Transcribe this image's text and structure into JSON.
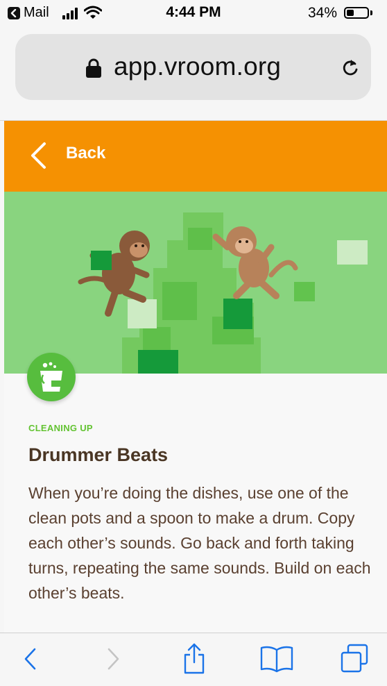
{
  "status_bar": {
    "back_app": "Mail",
    "time": "4:44 PM",
    "battery_percent": "34%",
    "battery_level": 0.34,
    "icons": [
      "back-arrow-icon",
      "signal-icon",
      "wifi-icon",
      "battery-icon"
    ]
  },
  "url_bar": {
    "domain": "app.vroom.org",
    "icons": [
      "lock-icon",
      "reload-icon"
    ]
  },
  "nav": {
    "back_label": "Back",
    "icon": "chevron-left-icon",
    "color": "#f59102"
  },
  "activity": {
    "category": "CLEANING UP",
    "title": "Drummer Beats",
    "description": "When you’re doing the dishes, use one of the clean pots and a spoon to make a drum. Copy each other’s sounds. Go back and forth taking turns, repeating the same sounds. Build on each other’s beats.",
    "badge_icon": "cleaning-bucket-icon",
    "illustration": "monkeys-illustration",
    "colors": {
      "category": "#63c332",
      "title": "#4a3624",
      "badge": "#57bd3e"
    }
  },
  "toolbar": {
    "items": [
      "back-icon",
      "forward-icon",
      "share-icon",
      "bookmarks-icon",
      "tabs-icon"
    ],
    "accent": "#1a73e8"
  }
}
